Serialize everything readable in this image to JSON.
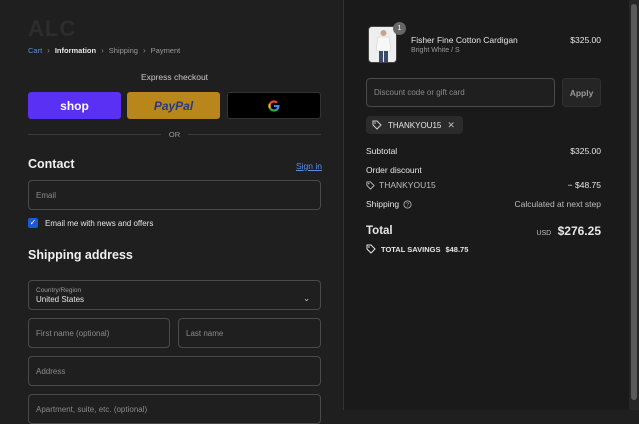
{
  "brand": {
    "logo_text": "ALC"
  },
  "breadcrumb": {
    "items": [
      {
        "label": "Cart",
        "state": "link"
      },
      {
        "label": "Information",
        "state": "current"
      },
      {
        "label": "Shipping",
        "state": "upcoming"
      },
      {
        "label": "Payment",
        "state": "upcoming"
      }
    ],
    "separator_icon": "chevron-right-icon"
  },
  "express_checkout": {
    "label": "Express checkout",
    "buttons": [
      {
        "label": "shop",
        "color": "#5a31f4"
      },
      {
        "label": "PayPal",
        "color": "#b8861a"
      },
      {
        "label": "G",
        "icon": "google-icon",
        "color": "#000000"
      }
    ],
    "divider_text": "OR"
  },
  "contact": {
    "title": "Contact",
    "sign_in_label": "Sign in",
    "email_placeholder": "Email",
    "newsletter_label": "Email me with news and offers",
    "newsletter_checked": true
  },
  "shipping": {
    "title": "Shipping address",
    "country_label": "Country/Region",
    "country_value": "United States",
    "first_name_placeholder": "First name (optional)",
    "last_name_placeholder": "Last name",
    "address_placeholder": "Address",
    "apartment_placeholder": "Apartment, suite, etc. (optional)"
  },
  "order": {
    "item": {
      "name": "Fisher Fine Cotton Cardigan",
      "variant": "Bright White / S",
      "price": "$325.00",
      "quantity": "1"
    },
    "discount_placeholder": "Discount code or gift card",
    "apply_label": "Apply",
    "applied_code": "THANKYOU15",
    "subtotal_label": "Subtotal",
    "subtotal_value": "$325.00",
    "order_discount_label": "Order discount",
    "discount_code": "THANKYOU15",
    "discount_value": "− $48.75",
    "shipping_label": "Shipping",
    "shipping_value": "Calculated at next step",
    "total_label": "Total",
    "total_currency": "USD",
    "total_value": "$276.25",
    "savings_label": "TOTAL SAVINGS",
    "savings_value": "$48.75"
  },
  "colors": {
    "accent": "#5b8fe6",
    "checkbox": "#1a5ad8",
    "background": "#1f1f1f",
    "panel": "#1a1a1a"
  }
}
